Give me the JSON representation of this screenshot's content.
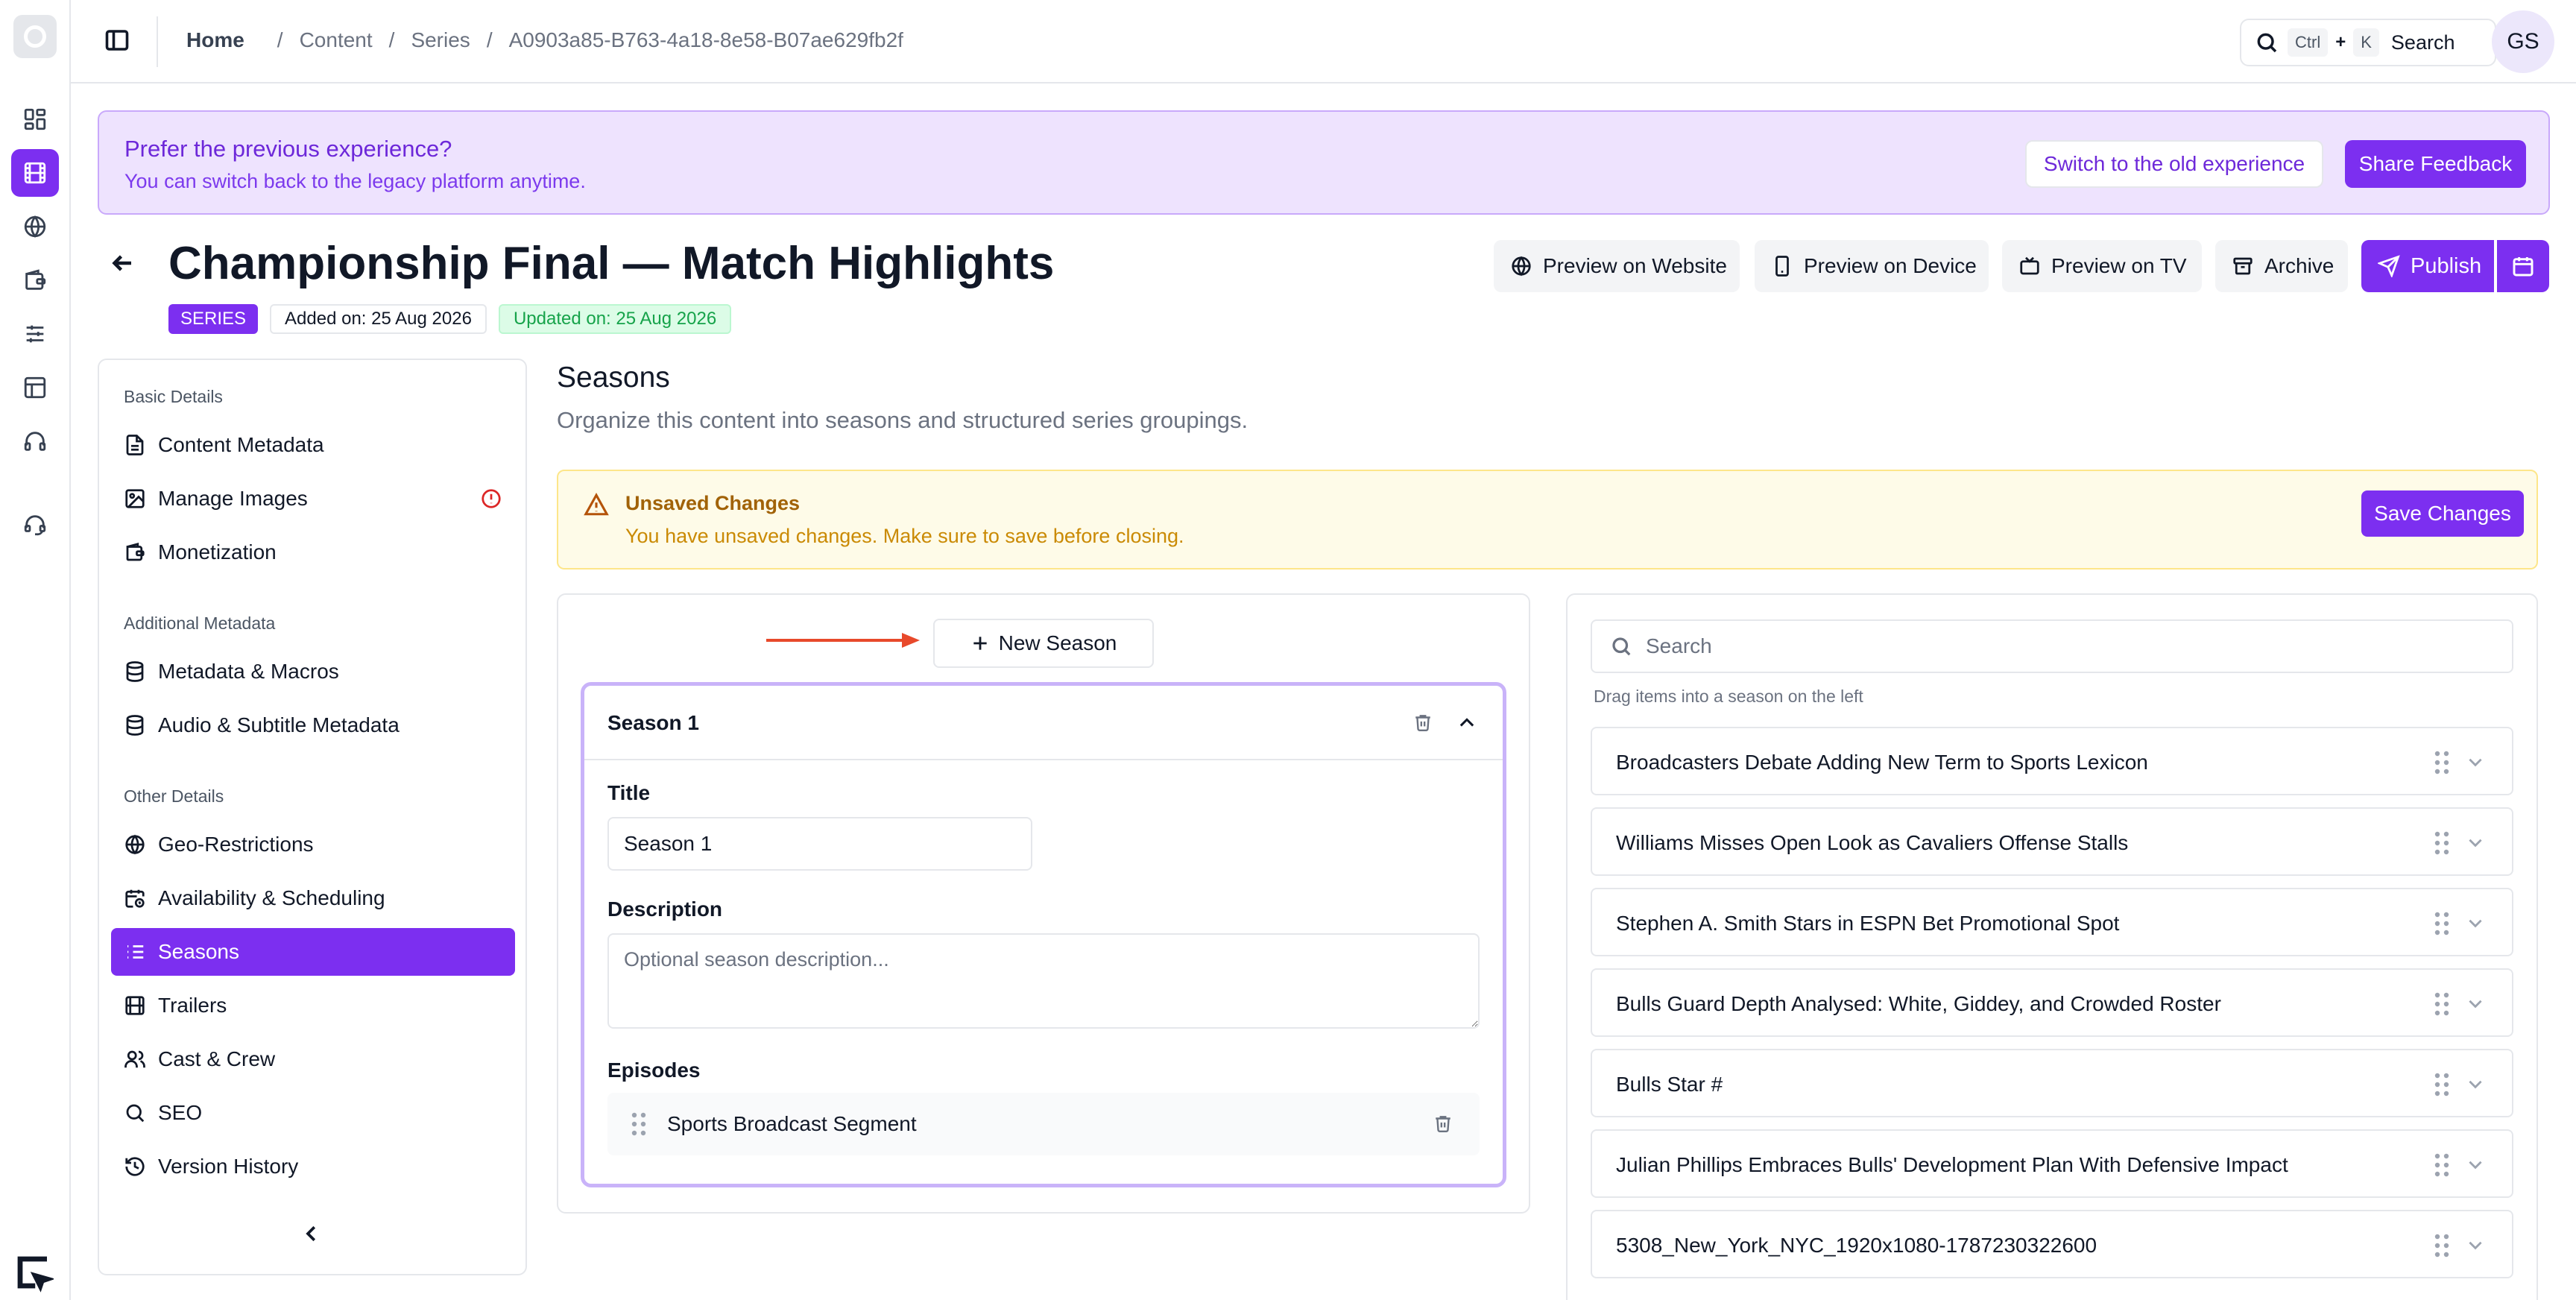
{
  "breadcrumb": {
    "home": "Home",
    "items": [
      "Content",
      "Series",
      "A0903a85-B763-4a18-8e58-B07ae629fb2f"
    ]
  },
  "search": {
    "key1": "Ctrl",
    "plus": "+",
    "key2": "K",
    "label": "Search"
  },
  "user": {
    "initials": "GS"
  },
  "banner": {
    "title": "Prefer the previous experience?",
    "subtitle": "You can switch back to the legacy platform anytime.",
    "switch_label": "Switch to the old experience",
    "feedback_label": "Share Feedback"
  },
  "header": {
    "title": "Championship Final — Match Highlights",
    "type_badge": "SERIES",
    "added": "Added on: 25 Aug 2026",
    "updated": "Updated on: 25 Aug 2026",
    "actions": {
      "preview_website": "Preview on Website",
      "preview_device": "Preview on Device",
      "preview_tv": "Preview on TV",
      "archive": "Archive",
      "publish": "Publish"
    }
  },
  "nav": {
    "groups": {
      "basic": "Basic Details",
      "additional": "Additional Metadata",
      "other": "Other Details"
    },
    "items": {
      "content_metadata": "Content Metadata",
      "manage_images": "Manage Images",
      "monetization": "Monetization",
      "metadata_macros": "Metadata & Macros",
      "audio_subtitle": "Audio & Subtitle Metadata",
      "geo": "Geo-Restrictions",
      "availability": "Availability & Scheduling",
      "seasons": "Seasons",
      "trailers": "Trailers",
      "cast": "Cast & Crew",
      "seo": "SEO",
      "version_history": "Version History"
    },
    "active": "seasons"
  },
  "section": {
    "title": "Seasons",
    "subtitle": "Organize this content into seasons and structured series groupings."
  },
  "unsaved": {
    "title": "Unsaved Changes",
    "message": "You have unsaved changes. Make sure to save before closing.",
    "save_label": "Save Changes"
  },
  "seasons": {
    "new_label": "New Season",
    "card": {
      "name": "Season 1",
      "title_label": "Title",
      "title_value": "Season 1",
      "description_label": "Description",
      "description_placeholder": "Optional season description...",
      "episodes_label": "Episodes",
      "episodes": [
        "Sports Broadcast Segment"
      ]
    }
  },
  "library": {
    "search_placeholder": "Search",
    "hint": "Drag items into a season on the left",
    "items": [
      "Broadcasters Debate Adding New Term to Sports Lexicon",
      "Williams Misses Open Look as Cavaliers Offense Stalls",
      "Stephen A. Smith Stars in ESPN Bet Promotional Spot",
      "Bulls Guard Depth Analysed: White, Giddey, and Crowded Roster",
      "Bulls Star #",
      "Julian Phillips Embraces Bulls' Development Plan With Defensive Impact",
      "5308_New_York_NYC_1920x1080-1787230322600"
    ]
  },
  "colors": {
    "accent": "#7c2ff0",
    "banner_bg": "#eee3fe",
    "warning_bg": "#fefbe8",
    "success_text": "#16a34a",
    "annotation_arrow": "#e8492b"
  },
  "icons": {
    "rail": [
      "dashboard-icon",
      "film-icon",
      "globe-icon",
      "wallet-icon",
      "sliders-icon",
      "layout-icon",
      "headphones-icon",
      "support-icon"
    ],
    "bottom": "screenshot-tool-icon"
  }
}
